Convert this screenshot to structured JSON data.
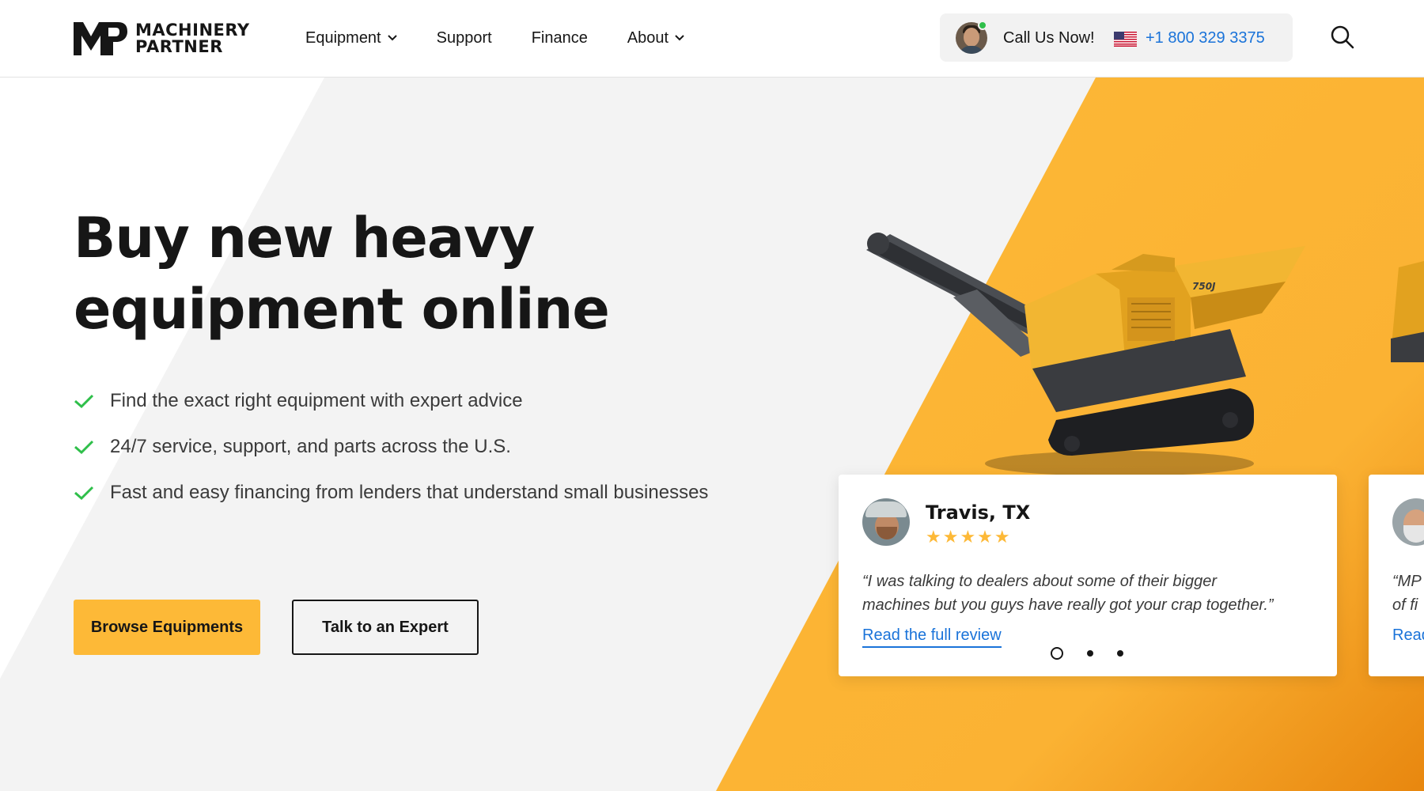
{
  "header": {
    "logo": {
      "line1": "MACHINERY",
      "line2": "PARTNER",
      "mark_text": "MP"
    },
    "nav": [
      {
        "label": "Equipment",
        "has_dropdown": true
      },
      {
        "label": "Support",
        "has_dropdown": false
      },
      {
        "label": "Finance",
        "has_dropdown": false
      },
      {
        "label": "About",
        "has_dropdown": true
      }
    ],
    "call": {
      "label": "Call Us Now!",
      "phone": "+1 800 329 3375",
      "flag_icon": "us-flag-icon",
      "status_color": "#2fbf4a"
    },
    "search_icon": "search-icon"
  },
  "hero": {
    "title_line1": "Buy new heavy",
    "title_line2": "equipment online",
    "benefits": [
      "Find the exact right equipment with expert advice",
      "24/7 service, support, and parts across the U.S.",
      "Fast and easy financing from lenders that understand small businesses"
    ],
    "primary_button": "Browse Equipments",
    "secondary_button": "Talk to an Expert",
    "machine_label": "750J"
  },
  "reviews": [
    {
      "name": "Travis, TX",
      "rating": 5,
      "stars": "★★★★★",
      "quote_line1": "“I was talking to dealers about some of their bigger",
      "quote_line2": "machines but you guys have really got your crap together.”",
      "link": "Read the full review"
    },
    {
      "quote_line1": "“MP",
      "quote_line2": "of fi",
      "link": "Read"
    }
  ],
  "carousel": {
    "active_index": 0,
    "count": 3
  },
  "colors": {
    "accent": "#fdb937",
    "link": "#1a73d9",
    "check": "#2fbf4a",
    "text": "#161616",
    "hero_bg": "#f3f3f3"
  }
}
